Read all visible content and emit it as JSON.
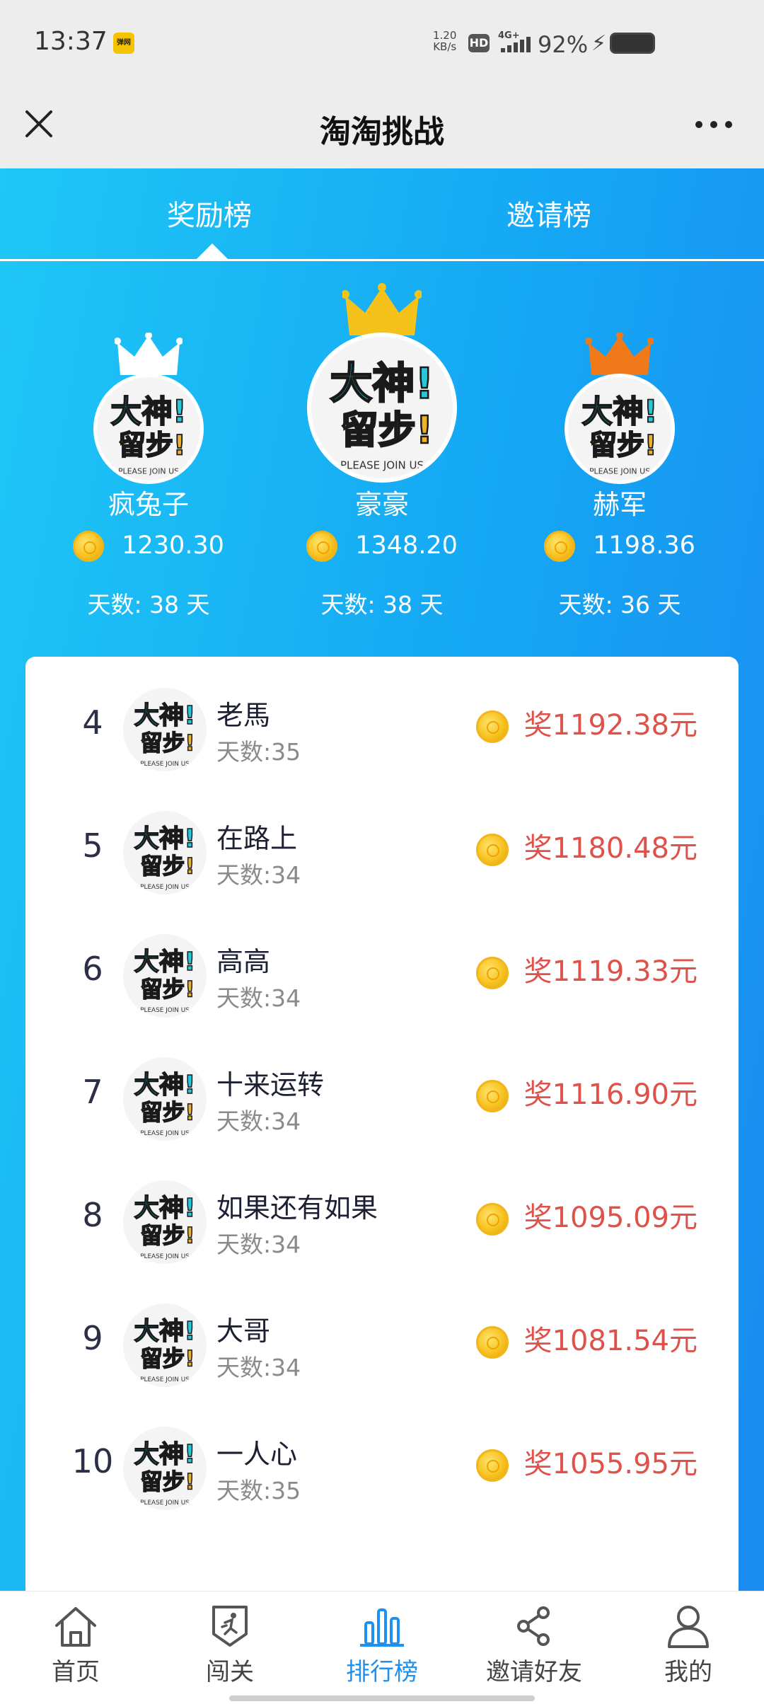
{
  "status_bar": {
    "time": "13:37",
    "app_badge": "弹网",
    "net_speed_value": "1.20",
    "net_speed_unit": "KB/s",
    "hd": "HD",
    "signal": "4G+",
    "battery": "92%"
  },
  "header": {
    "title": "淘淘挑战"
  },
  "tabs": [
    {
      "label": "奖励榜",
      "active": true
    },
    {
      "label": "邀请榜",
      "active": false
    }
  ],
  "podium": [
    {
      "rank": 2,
      "name": "疯兔子",
      "coins": "1230.30",
      "days": "天数: 38 天",
      "crown_color": "#ffffff"
    },
    {
      "rank": 1,
      "name": "豪豪",
      "coins": "1348.20",
      "days": "天数: 38 天",
      "crown_color": "#f5c21b"
    },
    {
      "rank": 3,
      "name": "赫军",
      "coins": "1198.36",
      "days": "天数: 36 天",
      "crown_color": "#f07a1a"
    }
  ],
  "avatar_text": {
    "line1": "大神!",
    "line2": "留步!",
    "line3": "PLEASE JOIN US"
  },
  "list": [
    {
      "rank": "4",
      "name": "老馬",
      "days": "天数:35",
      "reward": "奖1192.38元"
    },
    {
      "rank": "5",
      "name": "在路上",
      "days": "天数:34",
      "reward": "奖1180.48元"
    },
    {
      "rank": "6",
      "name": "高高",
      "days": "天数:34",
      "reward": "奖1119.33元"
    },
    {
      "rank": "7",
      "name": "十来运转",
      "days": "天数:34",
      "reward": "奖1116.90元"
    },
    {
      "rank": "8",
      "name": "如果还有如果",
      "days": "天数:34",
      "reward": "奖1095.09元"
    },
    {
      "rank": "9",
      "name": "大哥",
      "days": "天数:34",
      "reward": "奖1081.54元"
    },
    {
      "rank": "10",
      "name": "一人心",
      "days": "天数:35",
      "reward": "奖1055.95元"
    }
  ],
  "bottom_nav": [
    {
      "label": "首页",
      "icon": "home-icon",
      "active": false
    },
    {
      "label": "闯关",
      "icon": "badge-runner-icon",
      "active": false
    },
    {
      "label": "排行榜",
      "icon": "bar-chart-icon",
      "active": true
    },
    {
      "label": "邀请好友",
      "icon": "share-icon",
      "active": false
    },
    {
      "label": "我的",
      "icon": "user-icon",
      "active": false
    }
  ],
  "colors": {
    "accent": "#1e90ef",
    "reward_red": "#e0514a",
    "gradient_start": "#1ec7f6",
    "gradient_end": "#1a8bf0"
  }
}
